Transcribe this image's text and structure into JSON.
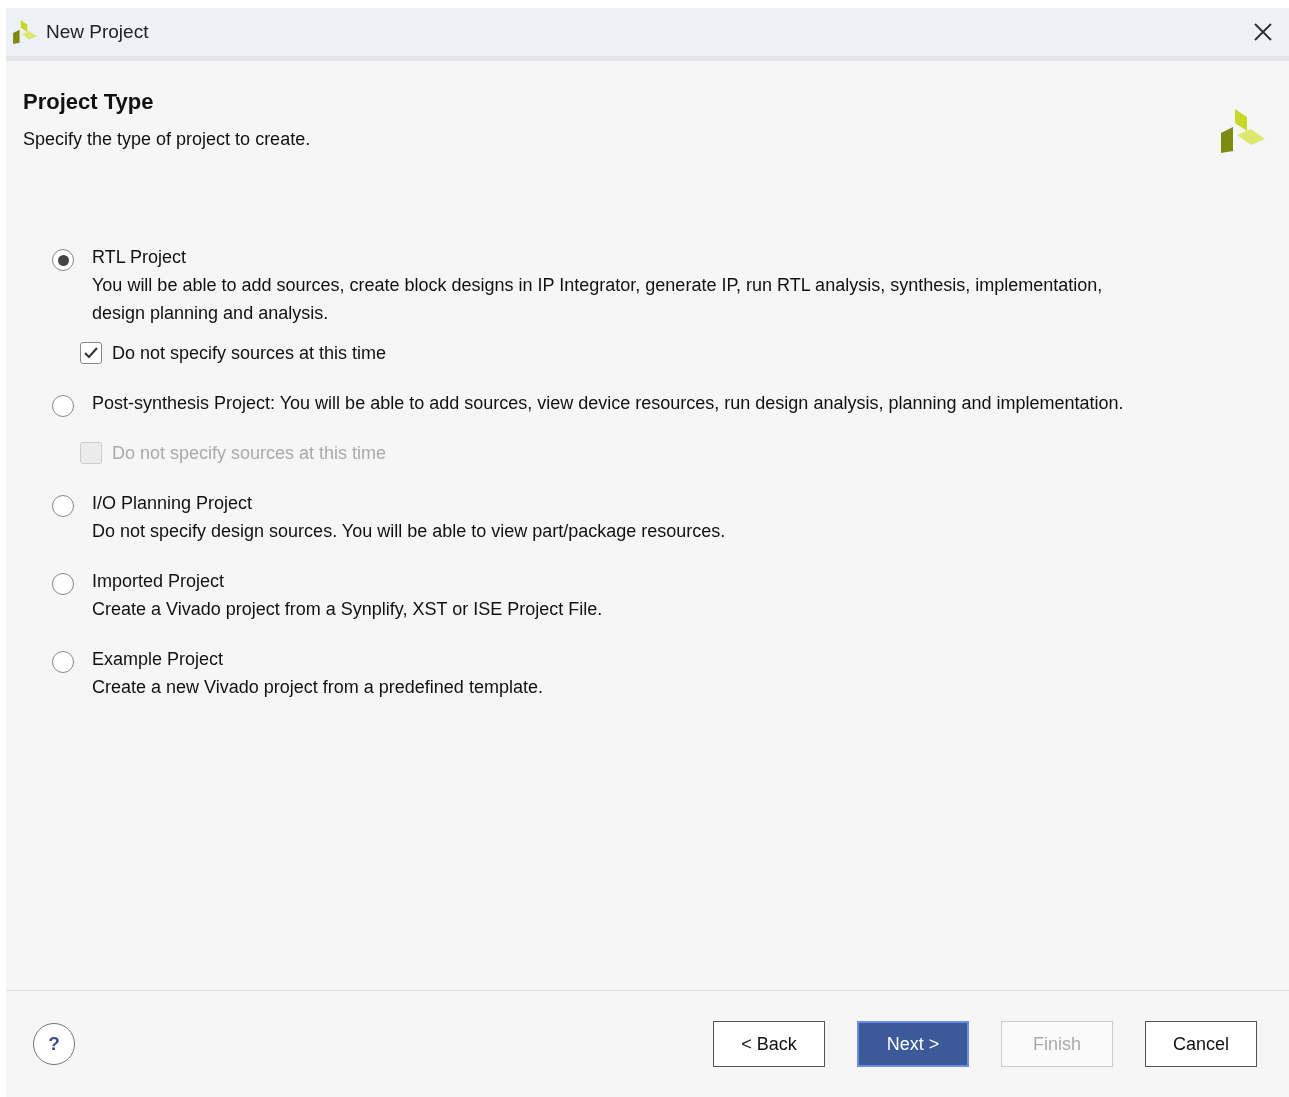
{
  "window": {
    "title": "New Project"
  },
  "header": {
    "title": "Project Type",
    "subtitle": "Specify the type of project to create."
  },
  "options": [
    {
      "label": "RTL Project",
      "description": "You will be able to add sources, create block designs in IP Integrator, generate IP, run RTL analysis, synthesis, implementation, design planning and analysis.",
      "selected": true,
      "checkbox": {
        "label": "Do not specify sources at this time",
        "checked": true,
        "disabled": false
      }
    },
    {
      "label": "Post-synthesis Project: You will be able to add sources, view device resources, run design analysis, planning and implementation.",
      "selected": false,
      "checkbox": {
        "label": "Do not specify sources at this time",
        "checked": false,
        "disabled": true
      }
    },
    {
      "label": "I/O Planning Project",
      "description": "Do not specify design sources. You will be able to view part/package resources.",
      "selected": false
    },
    {
      "label": "Imported Project",
      "description": "Create a Vivado project from a Synplify, XST or ISE Project File.",
      "selected": false
    },
    {
      "label": "Example Project",
      "description": "Create a new Vivado project from a predefined template.",
      "selected": false
    }
  ],
  "footer": {
    "help": "?",
    "buttons": [
      {
        "label": "< Back",
        "kind": "default",
        "disabled": false
      },
      {
        "label": "Next >",
        "kind": "primary",
        "disabled": false
      },
      {
        "label": "Finish",
        "kind": "default",
        "disabled": true
      },
      {
        "label": "Cancel",
        "kind": "default",
        "disabled": false
      }
    ]
  }
}
